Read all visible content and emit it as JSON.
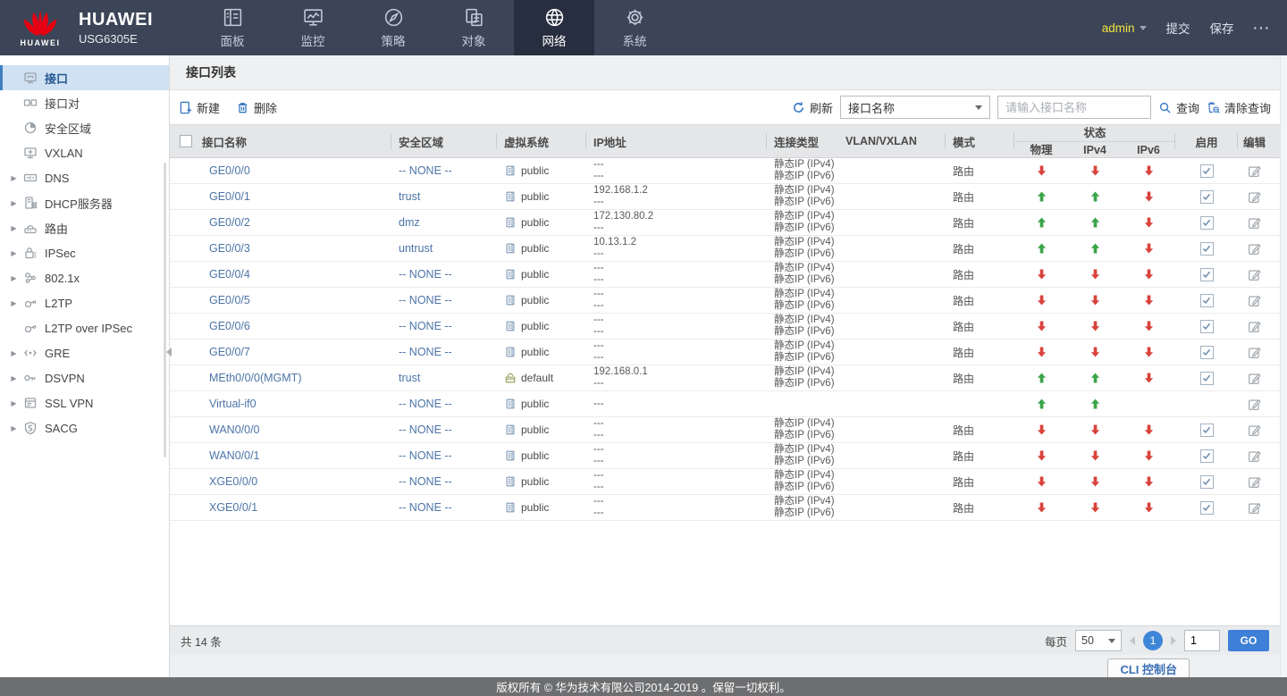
{
  "brand": {
    "company": "HUAWEI",
    "model": "USG6305E",
    "logo_text": "HUAWEI"
  },
  "topnav": {
    "items": [
      {
        "id": "dashboard",
        "label": "面板",
        "icon": "dashboard-icon"
      },
      {
        "id": "monitor",
        "label": "监控",
        "icon": "monitor-icon"
      },
      {
        "id": "policy",
        "label": "策略",
        "icon": "policy-icon"
      },
      {
        "id": "object",
        "label": "对象",
        "icon": "object-icon"
      },
      {
        "id": "network",
        "label": "网络",
        "icon": "network-icon"
      },
      {
        "id": "system",
        "label": "系统",
        "icon": "system-icon"
      }
    ],
    "active_index": 4,
    "user": "admin",
    "commit_label": "提交",
    "save_label": "保存",
    "more_label": "···"
  },
  "sidebar": {
    "items": [
      {
        "id": "interface",
        "label": "接口",
        "icon": "interface-icon",
        "selected": true,
        "expandable": false
      },
      {
        "id": "interface-pair",
        "label": "接口对",
        "icon": "interface-pair-icon",
        "selected": false,
        "expandable": false
      },
      {
        "id": "security-zone",
        "label": "安全区域",
        "icon": "security-zone-icon",
        "selected": false,
        "expandable": false
      },
      {
        "id": "vxlan",
        "label": "VXLAN",
        "icon": "vxlan-icon",
        "selected": false,
        "expandable": false
      },
      {
        "id": "dns",
        "label": "DNS",
        "icon": "dns-icon",
        "selected": false,
        "expandable": true
      },
      {
        "id": "dhcp-server",
        "label": "DHCP服务器",
        "icon": "dhcp-icon",
        "selected": false,
        "expandable": true
      },
      {
        "id": "route",
        "label": "路由",
        "icon": "route-icon",
        "selected": false,
        "expandable": true
      },
      {
        "id": "ipsec",
        "label": "IPSec",
        "icon": "ipsec-icon",
        "selected": false,
        "expandable": true
      },
      {
        "id": "dot1x",
        "label": "802.1x",
        "icon": "dot1x-icon",
        "selected": false,
        "expandable": true
      },
      {
        "id": "l2tp",
        "label": "L2TP",
        "icon": "l2tp-icon",
        "selected": false,
        "expandable": true
      },
      {
        "id": "l2tp-over-ipsec",
        "label": "L2TP over IPSec",
        "icon": "l2tp-ipsec-icon",
        "selected": false,
        "expandable": false
      },
      {
        "id": "gre",
        "label": "GRE",
        "icon": "gre-icon",
        "selected": false,
        "expandable": true
      },
      {
        "id": "dsvpn",
        "label": "DSVPN",
        "icon": "dsvpn-icon",
        "selected": false,
        "expandable": true
      },
      {
        "id": "ssl-vpn",
        "label": "SSL VPN",
        "icon": "sslvpn-icon",
        "selected": false,
        "expandable": true
      },
      {
        "id": "sacg",
        "label": "SACG",
        "icon": "sacg-icon",
        "selected": false,
        "expandable": true
      }
    ]
  },
  "content": {
    "title": "接口列表",
    "toolbar": {
      "new_label": "新建",
      "delete_label": "删除",
      "refresh_label": "刷新",
      "filter_field": "接口名称",
      "search_placeholder": "请输入接口名称",
      "query_label": "查询",
      "clear_query_label": "清除查询"
    },
    "table": {
      "headers": {
        "name": "接口名称",
        "zone": "安全区域",
        "vsys": "虚拟系统",
        "ip": "IP地址",
        "conn": "连接类型",
        "vlan": "VLAN/VXLAN",
        "mode": "模式",
        "status": "状态",
        "phy": "物理",
        "ipv4": "IPv4",
        "ipv6": "IPv6",
        "enable": "启用",
        "edit": "编辑"
      },
      "rows": [
        {
          "name": "GE0/0/0",
          "zone": "-- NONE --",
          "vsys_icon": "vsys-public-icon",
          "vsys": "public",
          "ip": [
            "---",
            "---"
          ],
          "conn": [
            "静态IP (IPv4)",
            "静态IP (IPv6)"
          ],
          "vlan": "",
          "mode": "路由",
          "phy": "down",
          "ipv4": "down",
          "ipv6": "down",
          "enabled": true
        },
        {
          "name": "GE0/0/1",
          "zone": "trust",
          "vsys_icon": "vsys-public-icon",
          "vsys": "public",
          "ip": [
            "192.168.1.2",
            "---"
          ],
          "conn": [
            "静态IP (IPv4)",
            "静态IP (IPv6)"
          ],
          "vlan": "",
          "mode": "路由",
          "phy": "up",
          "ipv4": "up",
          "ipv6": "down",
          "enabled": true
        },
        {
          "name": "GE0/0/2",
          "zone": "dmz",
          "vsys_icon": "vsys-public-icon",
          "vsys": "public",
          "ip": [
            "172.130.80.2",
            "---"
          ],
          "conn": [
            "静态IP (IPv4)",
            "静态IP (IPv6)"
          ],
          "vlan": "",
          "mode": "路由",
          "phy": "up",
          "ipv4": "up",
          "ipv6": "down",
          "enabled": true
        },
        {
          "name": "GE0/0/3",
          "zone": "untrust",
          "vsys_icon": "vsys-public-icon",
          "vsys": "public",
          "ip": [
            "10.13.1.2",
            "---"
          ],
          "conn": [
            "静态IP (IPv4)",
            "静态IP (IPv6)"
          ],
          "vlan": "",
          "mode": "路由",
          "phy": "up",
          "ipv4": "up",
          "ipv6": "down",
          "enabled": true
        },
        {
          "name": "GE0/0/4",
          "zone": "-- NONE --",
          "vsys_icon": "vsys-public-icon",
          "vsys": "public",
          "ip": [
            "---",
            "---"
          ],
          "conn": [
            "静态IP (IPv4)",
            "静态IP (IPv6)"
          ],
          "vlan": "",
          "mode": "路由",
          "phy": "down",
          "ipv4": "down",
          "ipv6": "down",
          "enabled": true
        },
        {
          "name": "GE0/0/5",
          "zone": "-- NONE --",
          "vsys_icon": "vsys-public-icon",
          "vsys": "public",
          "ip": [
            "---",
            "---"
          ],
          "conn": [
            "静态IP (IPv4)",
            "静态IP (IPv6)"
          ],
          "vlan": "",
          "mode": "路由",
          "phy": "down",
          "ipv4": "down",
          "ipv6": "down",
          "enabled": true
        },
        {
          "name": "GE0/0/6",
          "zone": "-- NONE --",
          "vsys_icon": "vsys-public-icon",
          "vsys": "public",
          "ip": [
            "---",
            "---"
          ],
          "conn": [
            "静态IP (IPv4)",
            "静态IP (IPv6)"
          ],
          "vlan": "",
          "mode": "路由",
          "phy": "down",
          "ipv4": "down",
          "ipv6": "down",
          "enabled": true
        },
        {
          "name": "GE0/0/7",
          "zone": "-- NONE --",
          "vsys_icon": "vsys-public-icon",
          "vsys": "public",
          "ip": [
            "---",
            "---"
          ],
          "conn": [
            "静态IP (IPv4)",
            "静态IP (IPv6)"
          ],
          "vlan": "",
          "mode": "路由",
          "phy": "down",
          "ipv4": "down",
          "ipv6": "down",
          "enabled": true
        },
        {
          "name": "MEth0/0/0(MGMT)",
          "zone": "trust",
          "vsys_icon": "vsys-default-icon",
          "vsys": "default",
          "ip": [
            "192.168.0.1",
            "---"
          ],
          "conn": [
            "静态IP (IPv4)",
            "静态IP (IPv6)"
          ],
          "vlan": "",
          "mode": "路由",
          "phy": "up",
          "ipv4": "up",
          "ipv6": "down",
          "enabled": true
        },
        {
          "name": "Virtual-if0",
          "zone": "-- NONE --",
          "vsys_icon": "vsys-public-icon",
          "vsys": "public",
          "ip": [
            "---"
          ],
          "conn": [],
          "vlan": "",
          "mode": "",
          "phy": "up",
          "ipv4": "up",
          "ipv6": "none",
          "enabled": null
        },
        {
          "name": "WAN0/0/0",
          "zone": "-- NONE --",
          "vsys_icon": "vsys-public-icon",
          "vsys": "public",
          "ip": [
            "---",
            "---"
          ],
          "conn": [
            "静态IP (IPv4)",
            "静态IP (IPv6)"
          ],
          "vlan": "",
          "mode": "路由",
          "phy": "down",
          "ipv4": "down",
          "ipv6": "down",
          "enabled": true
        },
        {
          "name": "WAN0/0/1",
          "zone": "-- NONE --",
          "vsys_icon": "vsys-public-icon",
          "vsys": "public",
          "ip": [
            "---",
            "---"
          ],
          "conn": [
            "静态IP (IPv4)",
            "静态IP (IPv6)"
          ],
          "vlan": "",
          "mode": "路由",
          "phy": "down",
          "ipv4": "down",
          "ipv6": "down",
          "enabled": true
        },
        {
          "name": "XGE0/0/0",
          "zone": "-- NONE --",
          "vsys_icon": "vsys-public-icon",
          "vsys": "public",
          "ip": [
            "---",
            "---"
          ],
          "conn": [
            "静态IP (IPv4)",
            "静态IP (IPv6)"
          ],
          "vlan": "",
          "mode": "路由",
          "phy": "down",
          "ipv4": "down",
          "ipv6": "down",
          "enabled": true
        },
        {
          "name": "XGE0/0/1",
          "zone": "-- NONE --",
          "vsys_icon": "vsys-public-icon",
          "vsys": "public",
          "ip": [
            "---",
            "---"
          ],
          "conn": [
            "静态IP (IPv4)",
            "静态IP (IPv6)"
          ],
          "vlan": "",
          "mode": "路由",
          "phy": "down",
          "ipv4": "down",
          "ipv6": "down",
          "enabled": true
        }
      ]
    },
    "footer": {
      "total": "共 14 条",
      "per_page_label": "每页",
      "per_page": "50",
      "current_page": "1",
      "goto_value": "1",
      "go_label": "GO"
    }
  },
  "cli_button": "CLI 控制台",
  "copyright": "版权所有 © 华为技术有限公司2014-2019 。保留一切权利。",
  "colors": {
    "nav_bg": "#3c4557",
    "nav_active_bg": "#272e3f",
    "admin_yellow": "#efe23d",
    "link_blue": "#4c74a8",
    "accent_blue": "#3e7fd8",
    "up_green": "#3aa449",
    "down_red": "#d8433b",
    "selected_sidebar_bg": "#cfe2f4",
    "header_bg": "#e4e6e8"
  }
}
